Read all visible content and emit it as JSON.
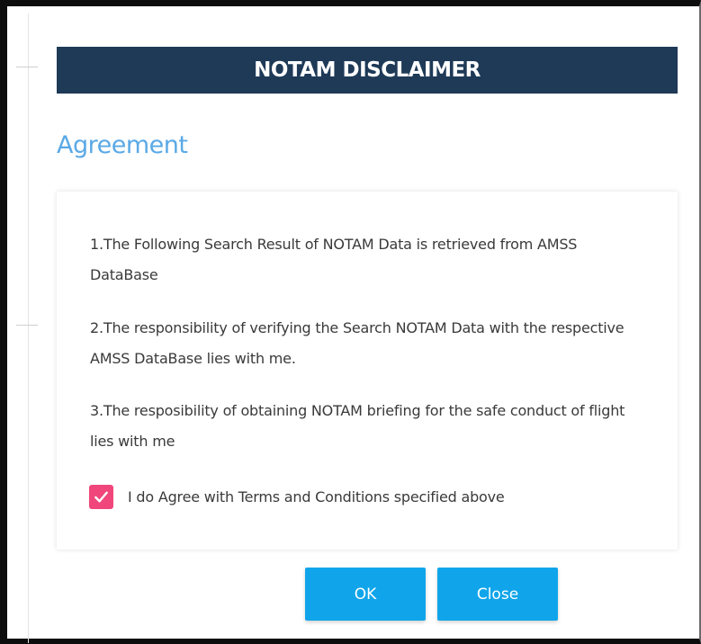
{
  "dialog": {
    "title": "NOTAM DISCLAIMER",
    "section_title": "Agreement",
    "colors": {
      "header_bg": "#1e3a57",
      "section_title": "#5aa9e6",
      "checkbox": "#f0467b",
      "button": "#10a5ea"
    }
  },
  "terms": [
    {
      "text": "1.The Following Search Result of NOTAM Data is retrieved from AMSS DataBase"
    },
    {
      "text": "2.The responsibility of verifying the Search NOTAM Data with the respective AMSS DataBase lies with me."
    },
    {
      "text": "3.The resposibility of obtaining NOTAM briefing for the safe conduct of flight lies with me"
    }
  ],
  "agree": {
    "label": "I do Agree with Terms and Conditions specified above",
    "checked": true,
    "icon": "checkmark-icon"
  },
  "buttons": {
    "ok_label": "OK",
    "close_label": "Close"
  }
}
